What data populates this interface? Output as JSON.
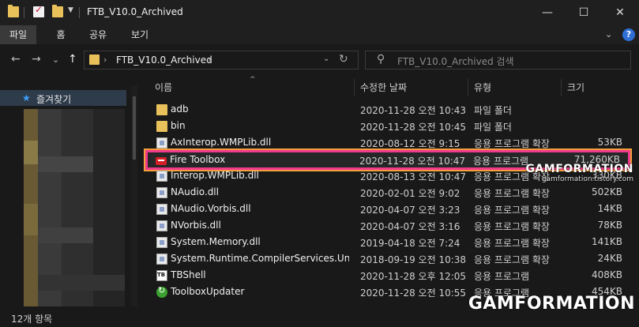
{
  "window": {
    "title": "FTB_V10.0_Archived",
    "minimize": "—",
    "maximize": "☐",
    "close": "✕"
  },
  "ribbon": {
    "tabs": [
      "파일",
      "홈",
      "공유",
      "보기"
    ],
    "active_tab": "파일",
    "collapse": "⌄",
    "help": "?"
  },
  "nav": {
    "back": "←",
    "forward": "→",
    "recent": "⌄",
    "up": "↑",
    "path": "FTB_V10.0_Archived",
    "refresh": "↻",
    "search_placeholder": "FTB_V10.0_Archived 검색"
  },
  "sidebar": {
    "quick_access": "즐겨찾기"
  },
  "columns": {
    "name": "이름",
    "date": "수정한 날짜",
    "type": "유형",
    "size": "크기",
    "sort_arrow": "^"
  },
  "files": [
    {
      "name": "adb",
      "date": "2020-11-28 오전 10:43",
      "type": "파일 폴더",
      "size": "",
      "icon": "folder-icon"
    },
    {
      "name": "bin",
      "date": "2020-11-28 오전 10:45",
      "type": "파일 폴더",
      "size": "",
      "icon": "folder-icon"
    },
    {
      "name": "AxInterop.WMPLib.dll",
      "date": "2020-08-12 오전 9:15",
      "type": "응용 프로그램 확장",
      "size": "53KB",
      "icon": "dll-icon"
    },
    {
      "name": "Fire Toolbox",
      "date": "2020-11-28 오전 10:47",
      "type": "응용 프로그램",
      "size": "71,260KB",
      "icon": "toolbox-icon"
    },
    {
      "name": "Interop.WMPLib.dll",
      "date": "2020-08-13 오전 10:47",
      "type": "응용 프로그램 확장",
      "size": "330KB",
      "icon": "dll-icon"
    },
    {
      "name": "NAudio.dll",
      "date": "2020-02-01 오전 9:02",
      "type": "응용 프로그램 확장",
      "size": "502KB",
      "icon": "dll-icon"
    },
    {
      "name": "NAudio.Vorbis.dll",
      "date": "2020-04-07 오전 3:23",
      "type": "응용 프로그램 확장",
      "size": "14KB",
      "icon": "dll-icon"
    },
    {
      "name": "NVorbis.dll",
      "date": "2020-04-07 오전 3:16",
      "type": "응용 프로그램 확장",
      "size": "78KB",
      "icon": "dll-icon"
    },
    {
      "name": "System.Memory.dll",
      "date": "2019-04-18 오전 7:24",
      "type": "응용 프로그램 확장",
      "size": "141KB",
      "icon": "dll-icon"
    },
    {
      "name": "System.Runtime.CompilerServices.Unsaf...",
      "date": "2018-09-19 오전 10:38",
      "type": "응용 프로그램 확장",
      "size": "24KB",
      "icon": "dll-icon"
    },
    {
      "name": "TBShell",
      "date": "2020-11-28 오후 12:05",
      "type": "응용 프로그램",
      "size": "408KB",
      "icon": "tbshell-icon"
    },
    {
      "name": "ToolboxUpdater",
      "date": "2020-11-28 오전 10:55",
      "type": "응용 프로그램",
      "size": "454KB",
      "icon": "updater-icon"
    }
  ],
  "watermark": {
    "brand": "GAMFORMATION",
    "site": "gamformation.tistory.com"
  },
  "status": {
    "item_count": "12개 항목"
  }
}
